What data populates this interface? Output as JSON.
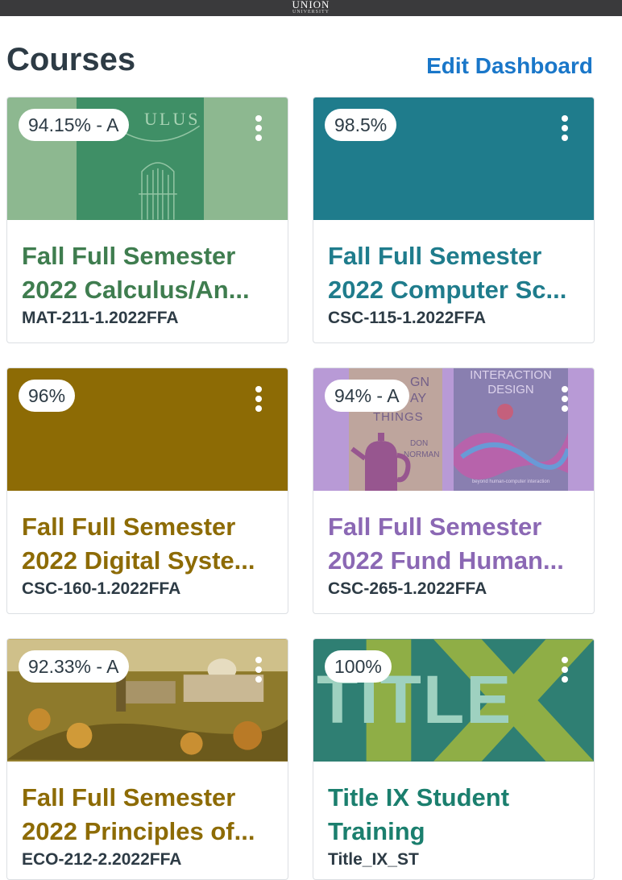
{
  "header": {
    "logo_text": "UNION",
    "logo_subtext": "UNIVERSITY"
  },
  "page": {
    "title": "Courses",
    "edit_label": "Edit Dashboard"
  },
  "colors": {
    "calculus": "#3f7d4f",
    "computer_science": "#1f7c8c",
    "digital_systems": "#8d6b05",
    "human_interaction": "#8b68b4",
    "principles": "#8d6b05",
    "title_ix": "#1b7f6e"
  },
  "courses": [
    {
      "grade": "94.15% - A",
      "title": "Fall Full Semester 2022 Calculus/An...",
      "code": "MAT-211-1.2022FFA",
      "hero_text": "ULUS"
    },
    {
      "grade": "98.5%",
      "title": "Fall Full Semester 2022 Computer Sc...",
      "code": "CSC-115-1.2022FFA"
    },
    {
      "grade": "96%",
      "title": "Fall Full Semester 2022 Digital Syste...",
      "code": "CSC-160-1.2022FFA"
    },
    {
      "grade": "94% - A",
      "title": "Fall Full Semester 2022 Fund Human...",
      "code": "CSC-265-1.2022FFA",
      "book1_lines": [
        "GN",
        "AY",
        "THINGS",
        "DON",
        "NORMAN"
      ],
      "book2_title": "INTERACTION DESIGN",
      "book2_sub": "beyond human-computer interaction"
    },
    {
      "grade": "92.33% - A",
      "title": "Fall Full Semester 2022 Principles of...",
      "code": "ECO-212-2.2022FFA"
    },
    {
      "grade": "100%",
      "title": "Title IX Student Training",
      "code": "Title_IX_ST",
      "hero_text": "TITLE",
      "hero_letters": "IX"
    }
  ]
}
